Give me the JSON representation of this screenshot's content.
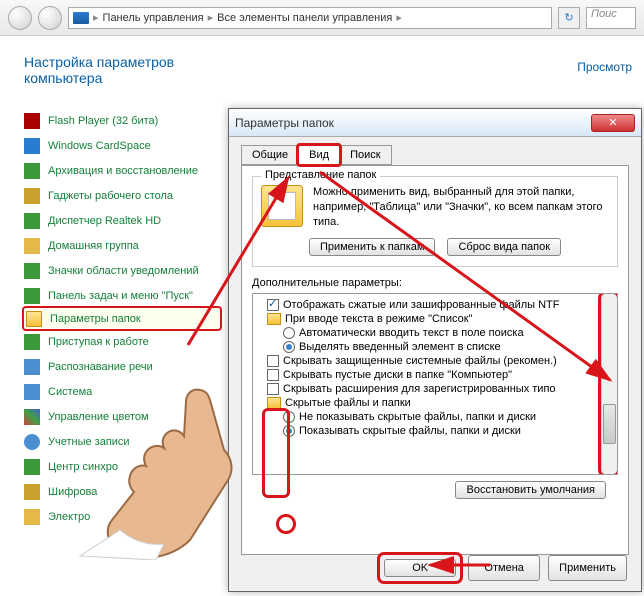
{
  "breadcrumb": {
    "item1": "Панель управления",
    "item2": "Все элементы панели управления"
  },
  "search": {
    "placeholder": "Поис"
  },
  "page": {
    "title": "Настройка параметров компьютера",
    "view_label": "Просмотр"
  },
  "sidebar": {
    "items": [
      {
        "label": "Flash Player (32 бита)"
      },
      {
        "label": "Windows CardSpace"
      },
      {
        "label": "Архивация и восстановление"
      },
      {
        "label": "Гаджеты рабочего стола"
      },
      {
        "label": "Диспетчер Realtek HD"
      },
      {
        "label": "Домашняя группа"
      },
      {
        "label": "Значки области уведомлений"
      },
      {
        "label": "Панель задач и меню \"Пуск\""
      },
      {
        "label": "Параметры папок"
      },
      {
        "label": "Приступая к работе"
      },
      {
        "label": "Распознавание речи"
      },
      {
        "label": "Система"
      },
      {
        "label": "Управление цветом"
      },
      {
        "label": "Учетные записи"
      },
      {
        "label": "Центр синхро"
      },
      {
        "label": "Шифрова"
      },
      {
        "label": "Электро"
      }
    ]
  },
  "dialog": {
    "title": "Параметры папок",
    "tabs": {
      "general": "Общие",
      "view": "Вид",
      "search": "Поиск"
    },
    "folder_view": {
      "group": "Представление папок",
      "desc": "Можно применить вид, выбранный для этой папки, например, \"Таблица\" или \"Значки\", ко всем папкам этого типа.",
      "apply_btn": "Применить к папкам",
      "reset_btn": "Сброс вида папок"
    },
    "advanced": {
      "label": "Дополнительные параметры:",
      "items": [
        {
          "type": "chk",
          "on": true,
          "text": "Отображать сжатые или зашифрованные файлы NTF"
        },
        {
          "type": "txt",
          "text": "При вводе текста в режиме \"Список\""
        },
        {
          "type": "rad",
          "on": false,
          "sub": true,
          "text": "Автоматически вводить текст в поле поиска"
        },
        {
          "type": "rad",
          "on": true,
          "sub": true,
          "text": "Выделять введенный элемент в списке"
        },
        {
          "type": "chk",
          "on": false,
          "text": "Скрывать защищенные системные файлы (рекомен.)"
        },
        {
          "type": "chk",
          "on": false,
          "text": "Скрывать пустые диски в папке \"Компьютер\""
        },
        {
          "type": "chk",
          "on": false,
          "text": "Скрывать расширения для зарегистрированных типо"
        },
        {
          "type": "fld",
          "text": "Скрытые файлы и папки"
        },
        {
          "type": "rad",
          "on": false,
          "sub": true,
          "text": "Не показывать скрытые файлы, папки и диски"
        },
        {
          "type": "rad",
          "on": true,
          "sub": true,
          "text": "Показывать скрытые файлы, папки и диски"
        }
      ],
      "restore_btn": "Восстановить умолчания"
    },
    "buttons": {
      "ok": "OK",
      "cancel": "Отмена",
      "apply": "Применить"
    }
  }
}
